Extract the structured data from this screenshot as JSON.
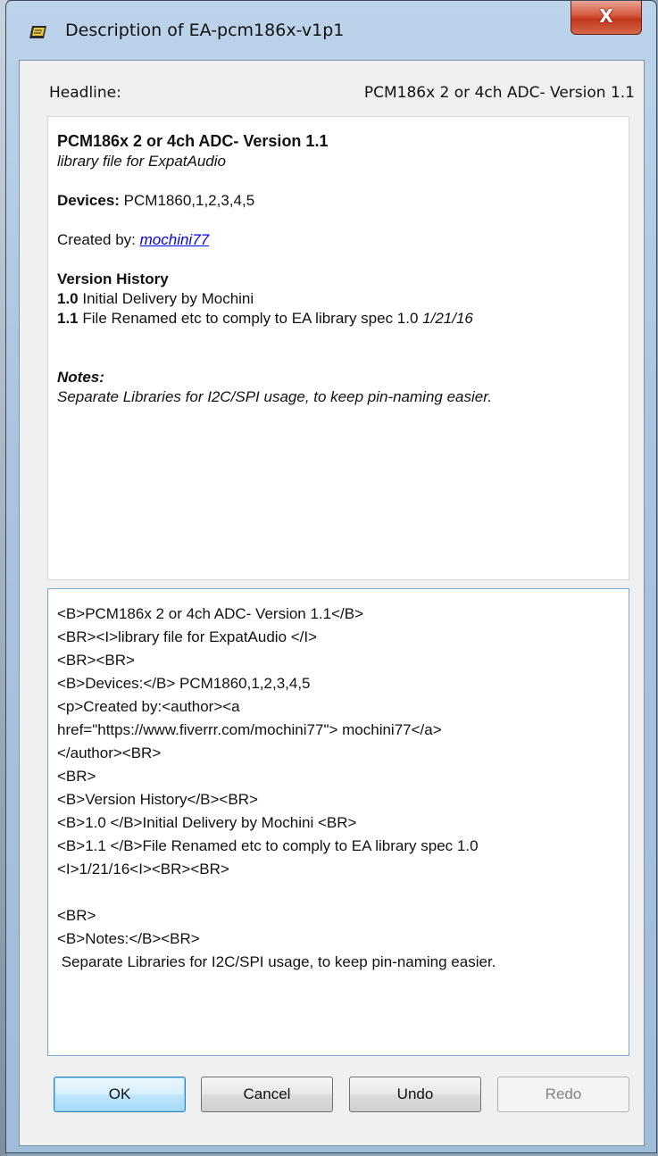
{
  "window": {
    "title": "Description of EA-pcm186x-v1p1",
    "close_glyph": "X"
  },
  "headline": {
    "label": "Headline:",
    "value": "PCM186x 2 or 4ch ADC- Version 1.1"
  },
  "preview": {
    "title": "PCM186x 2 or 4ch ADC- Version 1.1",
    "subtitle": "library file for ExpatAudio",
    "devices_label": "Devices:",
    "devices_value": "PCM1860,1,2,3,4,5",
    "created_by_label": "Created by:",
    "author": "mochini77",
    "version_history_label": "Version History",
    "v10_num": "1.0",
    "v10_text": "Initial Delivery by Mochini",
    "v11_num": "1.1",
    "v11_text": "File Renamed etc to comply to EA library spec 1.0",
    "v11_date": "1/21/16",
    "notes_label": "Notes:",
    "notes_text": "Separate Libraries for I2C/SPI usage, to keep pin-naming easier."
  },
  "source": {
    "text": "<B>PCM186x 2 or 4ch ADC- Version 1.1</B>\n<BR><I>library file for ExpatAudio </I>\n<BR><BR>\n<B>Devices:</B> PCM1860,1,2,3,4,5\n<p>Created by:<author><a\nhref=\"https://www.fiverrr.com/mochini77\"> mochini77</a>\n</author><BR>\n<BR>\n<B>Version History</B><BR>\n<B>1.0 </B>Initial Delivery by Mochini <BR>\n<B>1.1 </B>File Renamed etc to comply to EA library spec 1.0\n<I>1/21/16<I><BR><BR>\n\n<BR>\n<B>Notes:</B><BR>\n Separate Libraries for I2C/SPI usage, to keep pin-naming easier."
  },
  "buttons": {
    "ok": "OK",
    "cancel": "Cancel",
    "undo": "Undo",
    "redo": "Redo"
  }
}
